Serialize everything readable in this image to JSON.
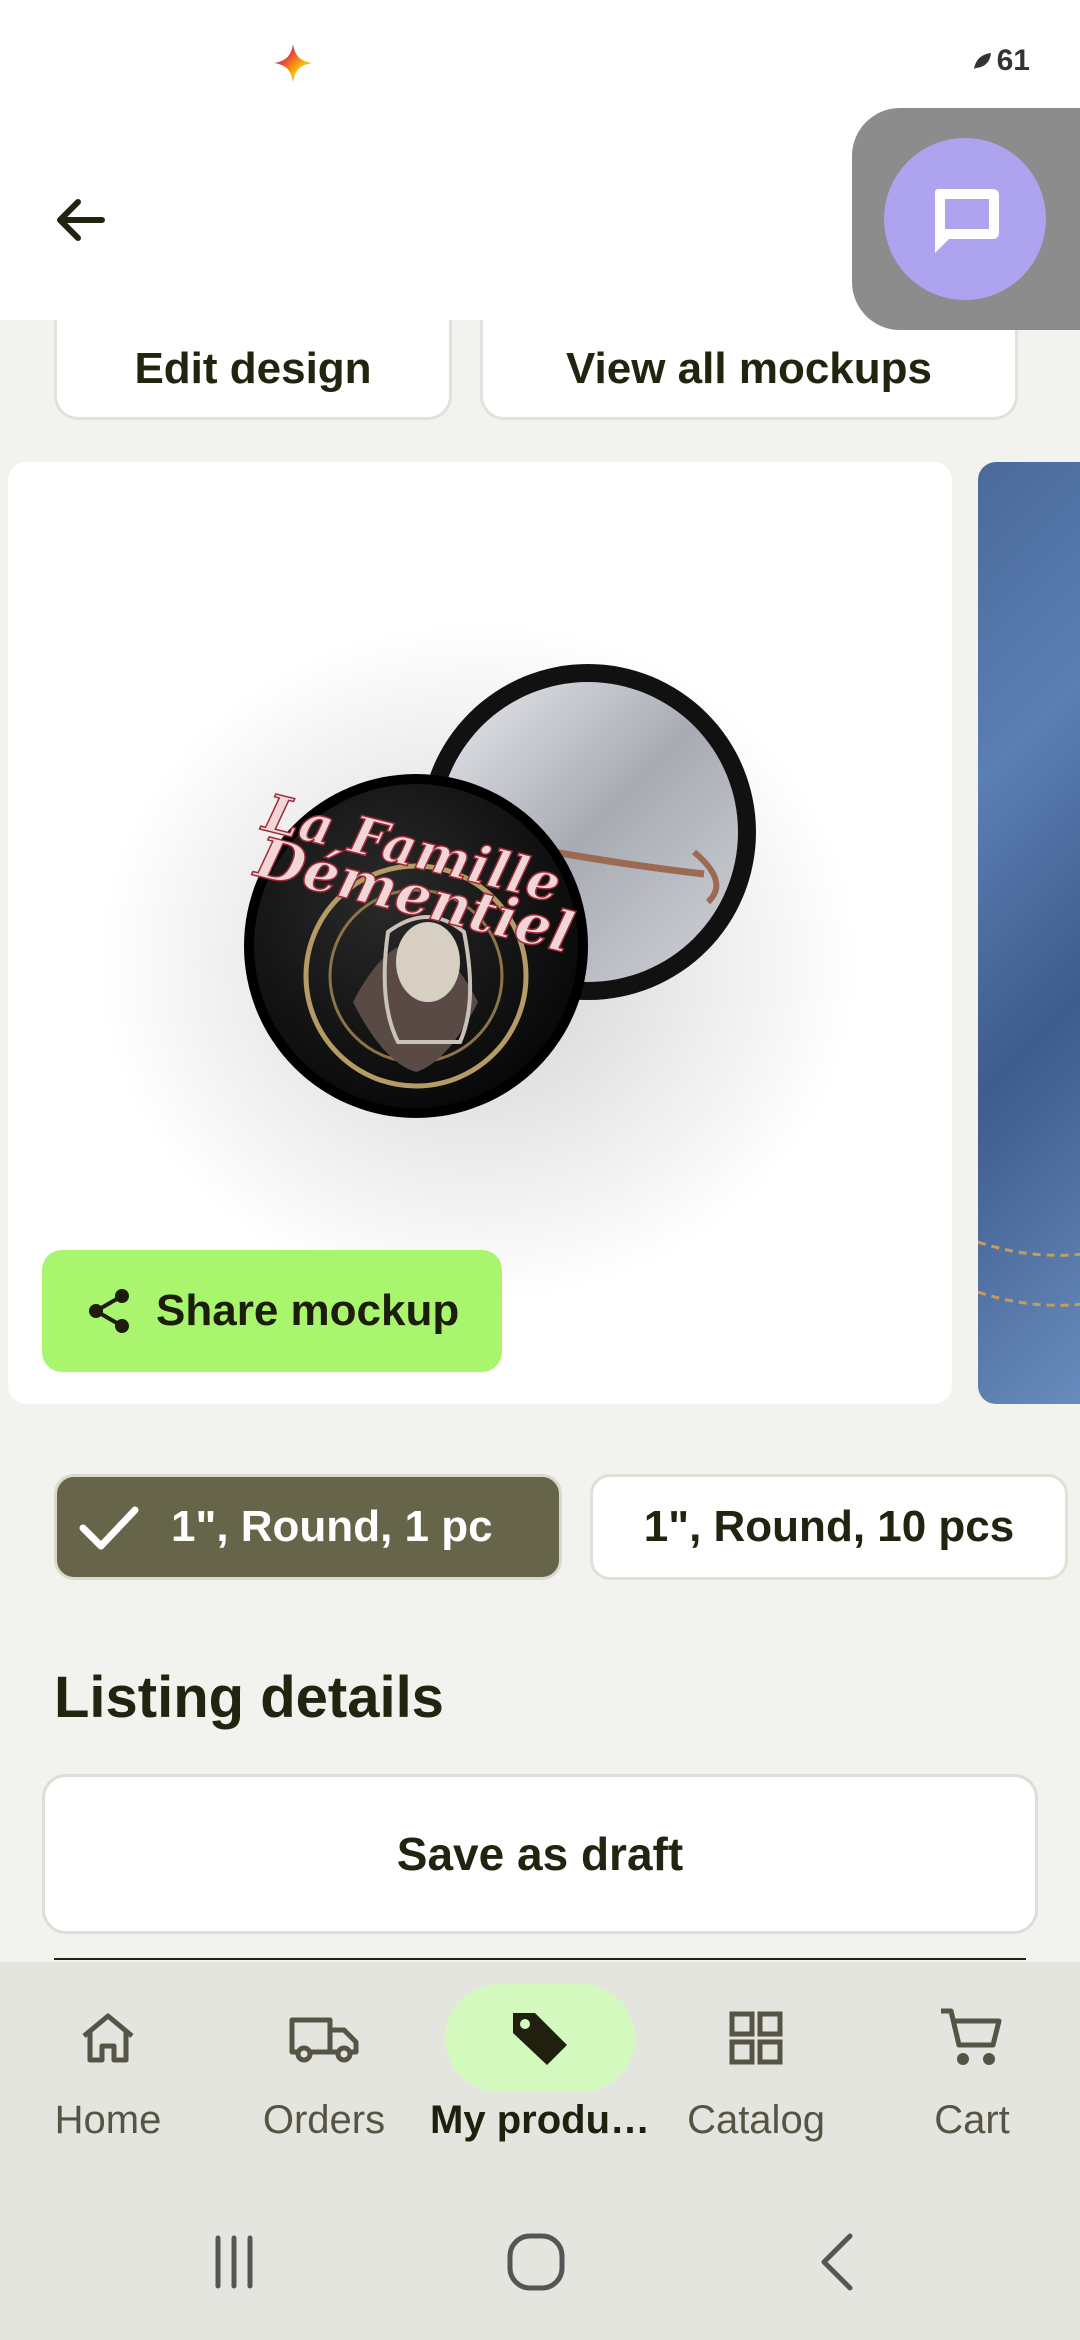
{
  "status": {
    "battery": "61"
  },
  "colors": {
    "accent_green": "#a9f56e",
    "selected_chip": "#66654a",
    "chat_bubble": "#aea3ef",
    "nav_active_bg": "#d4f9bf"
  },
  "appbar": {
    "back_icon": "arrow-left-icon"
  },
  "actions": {
    "edit_design": "Edit design",
    "view_all_mockups": "View all mockups"
  },
  "mockup": {
    "share_label": "Share mockup",
    "design_text_line1": "La Famille",
    "design_text_line2": "Démentiel"
  },
  "variants": [
    {
      "label": "1\", Round, 1 pc",
      "selected": true
    },
    {
      "label": "1\", Round, 10 pcs",
      "selected": false
    }
  ],
  "listing": {
    "title": "Listing details",
    "save_draft": "Save as draft"
  },
  "bottom_nav": [
    {
      "label": "Home",
      "icon": "home-icon"
    },
    {
      "label": "Orders",
      "icon": "truck-icon"
    },
    {
      "label": "My produ…",
      "icon": "tag-icon",
      "active": true
    },
    {
      "label": "Catalog",
      "icon": "grid-icon"
    },
    {
      "label": "Cart",
      "icon": "cart-icon"
    }
  ]
}
